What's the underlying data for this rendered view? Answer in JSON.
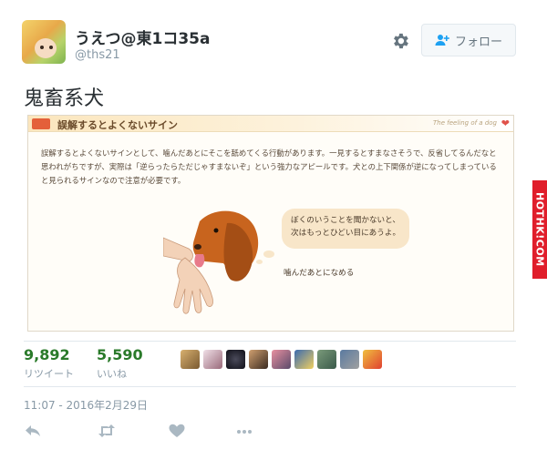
{
  "user": {
    "display_name": "うえつ@東1コ35a",
    "screen_name": "@ths21"
  },
  "follow_button": {
    "label": "フォロー",
    "icon": "person-plus-icon"
  },
  "settings_icon": "gear-icon",
  "tweet": {
    "text": "鬼畜系犬"
  },
  "media": {
    "header_title": "誤解するとよくないサイン",
    "header_right": "The feeling of a dog",
    "body_text": "誤解するとよくないサインとして、噛んだあとにそこを舐めてくる行動があります。一見するとすまなさそうで、反省してるんだなと思われがちですが、実際は「逆らったらただじゃすまないぞ」という強力なアピールです。犬との上下関係が逆になってしまっていると見られるサインなので注意が必要です。",
    "bubble_line1": "ぼくのいうことを聞かないと、",
    "bubble_line2": "次はもっとひどい目にあうよ。",
    "caption": "噛んだあとになめる"
  },
  "watermark": "HOTHK!COM",
  "stats": {
    "retweets": {
      "count": "9,892",
      "label": "リツイート"
    },
    "likes": {
      "count": "5,590",
      "label": "いいね"
    }
  },
  "timestamp": "11:07 - 2016年2月29日",
  "colors": {
    "count_green": "#2a7a2a",
    "muted": "#8899a6",
    "watermark_red": "#e01e2b"
  }
}
